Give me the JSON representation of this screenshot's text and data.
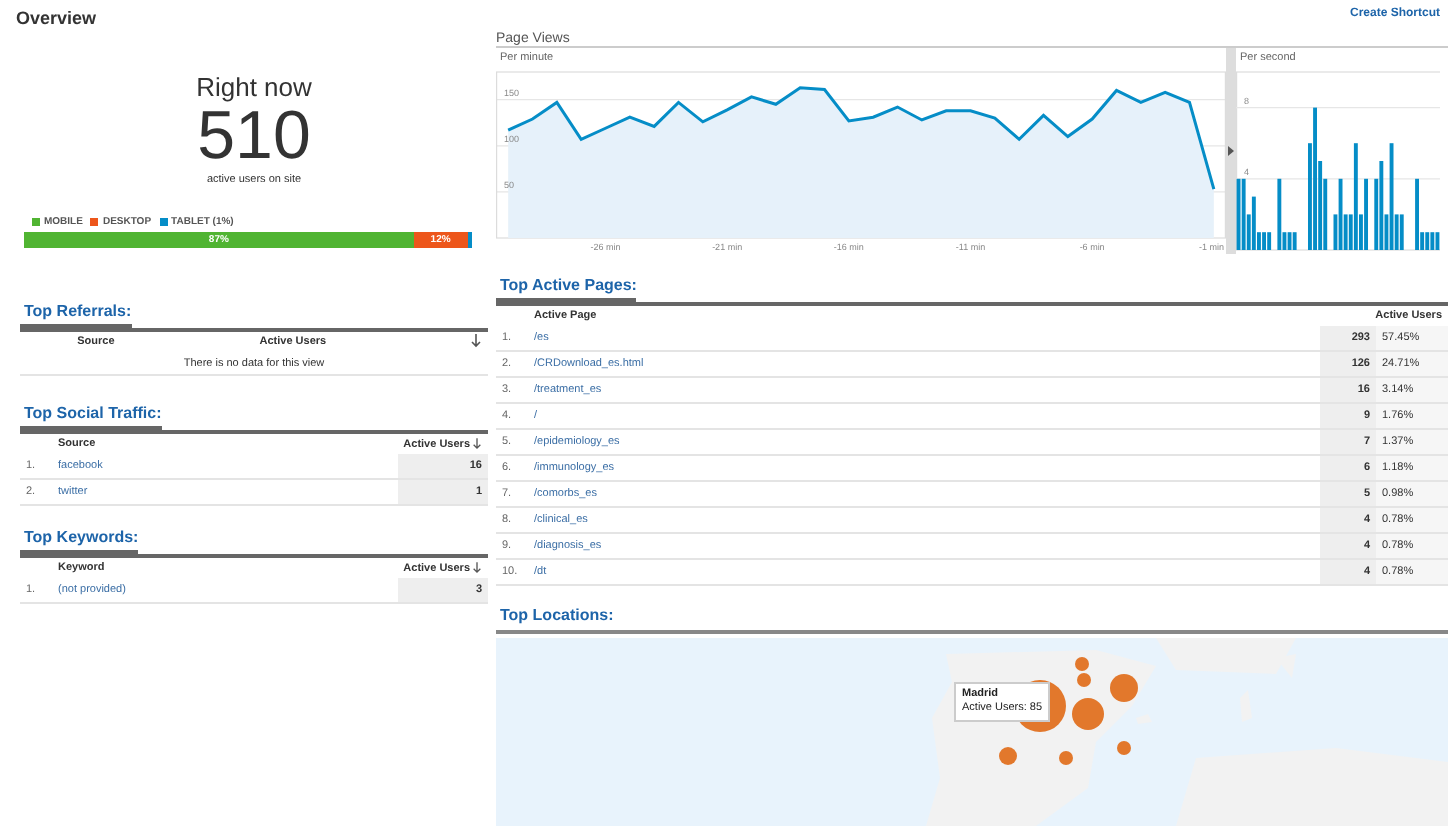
{
  "header": {
    "title": "Overview",
    "shortcut_link": "Create Shortcut"
  },
  "right_now": {
    "title": "Right now",
    "count": "510",
    "caption": "active users on site",
    "devices": [
      {
        "label": "MOBILE",
        "color": "#50b432",
        "bar_label": "87%"
      },
      {
        "label": "DESKTOP",
        "color": "#ed561b",
        "bar_label": "12%"
      },
      {
        "label": "TABLET (1%)",
        "color": "#058dc7"
      }
    ]
  },
  "page_views": {
    "title": "Page Views",
    "per_minute": {
      "label": "Per minute",
      "chart_data": {
        "type": "area",
        "x": [
          -30,
          -29,
          -28,
          -27,
          -26,
          -25,
          -24,
          -23,
          -22,
          -21,
          -20,
          -19,
          -18,
          -17,
          -16,
          -15,
          -14,
          -13,
          -12,
          -11,
          -10,
          -9,
          -8,
          -7,
          -6,
          -5,
          -4,
          -3,
          -2,
          -1
        ],
        "xlim": [
          -30.5,
          -0.5
        ],
        "ylim": [
          0,
          180
        ],
        "grid": true,
        "series": [
          {
            "color": "#058dc7",
            "values": [
              117,
              129,
              147,
              107,
              119,
              131,
              121,
              147,
              126,
              139,
              153,
              145,
              163,
              161,
              127,
              131,
              142,
              128,
              138,
              138,
              130,
              107,
              133,
              110,
              129,
              160,
              147,
              158,
              147,
              53
            ]
          }
        ],
        "yticks": [
          {
            "value": 150,
            "label": "150"
          },
          {
            "value": 100,
            "label": "100"
          },
          {
            "value": 50,
            "label": "50"
          }
        ],
        "xticks": [
          {
            "value": -26,
            "label": "-26 min"
          },
          {
            "value": -21,
            "label": "-21 min"
          },
          {
            "value": -16,
            "label": "-16 min"
          },
          {
            "value": -11,
            "label": "-11 min"
          },
          {
            "value": -6,
            "label": "-6 min"
          },
          {
            "value": -1,
            "label": "-1 min"
          }
        ]
      }
    },
    "per_second": {
      "label": "Per second",
      "chart_data": {
        "type": "bar",
        "values": [
          4,
          4,
          2,
          3,
          1,
          1,
          1,
          0,
          4,
          1,
          1,
          1,
          0,
          0,
          6,
          8,
          5,
          4,
          0,
          2,
          4,
          2,
          2,
          6,
          2,
          4,
          0,
          4,
          5,
          2,
          6,
          2,
          2,
          0,
          0,
          4,
          1,
          1,
          1,
          1
        ],
        "ylim": [
          0,
          10
        ],
        "grid": true,
        "yticks": [
          {
            "value": 8,
            "label": "8"
          },
          {
            "value": 4,
            "label": "4"
          }
        ]
      }
    }
  },
  "top_referrals": {
    "title": "Top Referrals:",
    "columns": [
      "Source",
      "Active Users"
    ],
    "empty_message": "There is no data for this view"
  },
  "top_social_traffic": {
    "title": "Top Social Traffic:",
    "columns": [
      "Source",
      "Active Users"
    ],
    "rows": [
      {
        "rank": "1.",
        "name": "facebook",
        "users": "16"
      },
      {
        "rank": "2.",
        "name": "twitter",
        "users": "1"
      }
    ]
  },
  "top_keywords": {
    "title": "Top Keywords:",
    "columns": [
      "Keyword",
      "Active Users"
    ],
    "rows": [
      {
        "rank": "1.",
        "name": "(not provided)",
        "users": "3"
      }
    ]
  },
  "top_active_pages": {
    "title": "Top Active Pages:",
    "columns": [
      "Active Page",
      "Active Users"
    ],
    "rows": [
      {
        "rank": "1.",
        "name": "/es",
        "users": "293",
        "share": "57.45%"
      },
      {
        "rank": "2.",
        "name": "/CRDownload_es.html",
        "users": "126",
        "share": "24.71%"
      },
      {
        "rank": "3.",
        "name": "/treatment_es",
        "users": "16",
        "share": "3.14%"
      },
      {
        "rank": "4.",
        "name": "/",
        "users": "9",
        "share": "1.76%"
      },
      {
        "rank": "5.",
        "name": "/epidemiology_es",
        "users": "7",
        "share": "1.37%"
      },
      {
        "rank": "6.",
        "name": "/immunology_es",
        "users": "6",
        "share": "1.18%"
      },
      {
        "rank": "7.",
        "name": "/comorbs_es",
        "users": "5",
        "share": "0.98%"
      },
      {
        "rank": "8.",
        "name": "/clinical_es",
        "users": "4",
        "share": "0.78%"
      },
      {
        "rank": "9.",
        "name": "/diagnosis_es",
        "users": "4",
        "share": "0.78%"
      },
      {
        "rank": "10.",
        "name": "/dt",
        "users": "4",
        "share": "0.78%"
      }
    ]
  },
  "top_locations": {
    "title": "Top Locations:",
    "tooltip": {
      "city": "Madrid",
      "label": "Active Users: 85"
    }
  }
}
